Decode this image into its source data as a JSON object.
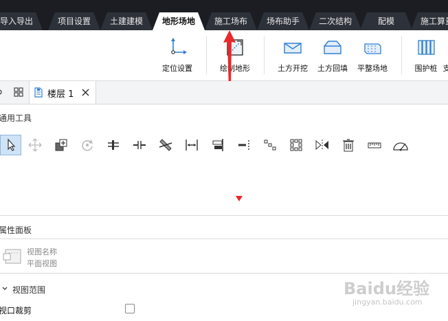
{
  "top_tabs": [
    {
      "label": "导入导出"
    },
    {
      "label": "项目设置"
    },
    {
      "label": "土建建模"
    },
    {
      "label": "地形场地"
    },
    {
      "label": "施工场布"
    },
    {
      "label": "场布助手"
    },
    {
      "label": "二次结构"
    },
    {
      "label": "配模"
    },
    {
      "label": "施工算量"
    }
  ],
  "active_tab": "地形场地",
  "ribbon": {
    "locate": "定位设置",
    "draw_terrain": "绘制地形",
    "excavate": "土方开挖",
    "backfill": "土方回填",
    "level_site": "平整场地",
    "retaining_pile": "围护桩",
    "support_partial": "支"
  },
  "view_tab": {
    "label": "楼层 1"
  },
  "tools_panel": {
    "title": "通用工具"
  },
  "properties": {
    "title": "属性面板",
    "view_name_label": "视图名称",
    "view_name_value": "平面视图",
    "view_range_section": "视图范围",
    "crop_label": "视口裁剪"
  },
  "watermark": {
    "text": "Baidu经验",
    "url": "jingyan.baidu.com"
  },
  "colors": {
    "accent": "#2f7fd1",
    "arrow": "#e8282b",
    "tab_dark": "#2d3139",
    "topbar": "#1b1d23"
  }
}
